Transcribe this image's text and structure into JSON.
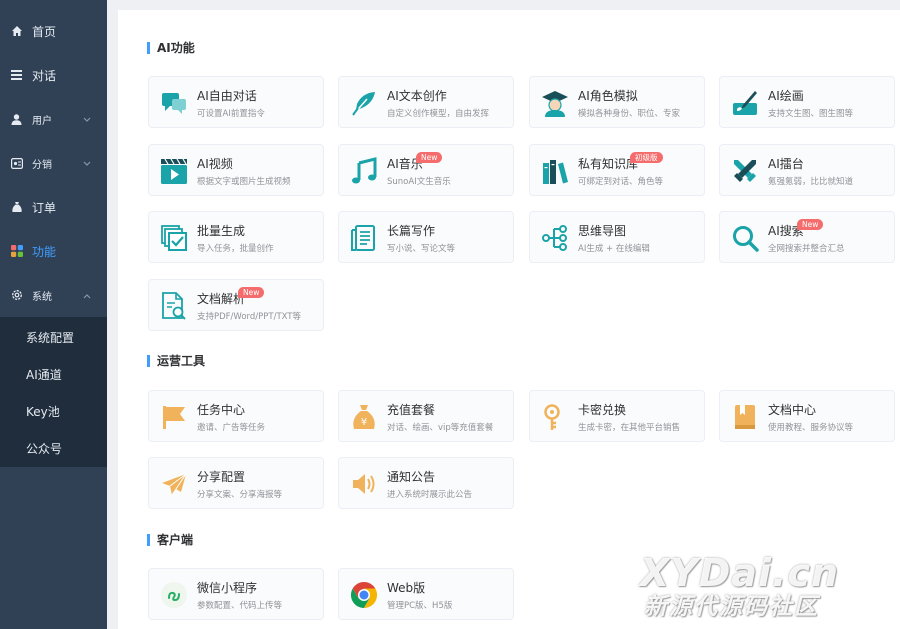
{
  "sidebar": {
    "items": [
      {
        "label": "首页",
        "icon": "home-icon"
      },
      {
        "label": "对话",
        "icon": "menu-icon"
      },
      {
        "label": "用户",
        "icon": "user-icon"
      },
      {
        "label": "分销",
        "icon": "share-icon"
      },
      {
        "label": "订单",
        "icon": "bag-icon"
      },
      {
        "label": "功能",
        "icon": "apps-icon"
      },
      {
        "label": "系统",
        "icon": "gear-icon"
      }
    ],
    "submenu": [
      "系统配置",
      "AI通道",
      "Key池",
      "公众号"
    ],
    "active_color": "#409eff"
  },
  "sections": {
    "ai": {
      "title": "AI功能",
      "cards": [
        {
          "title": "AI自由对话",
          "desc": "可设置AI前置指令",
          "icon": "chat-icon"
        },
        {
          "title": "AI文本创作",
          "desc": "自定义创作模型，自由发挥",
          "icon": "feather-icon"
        },
        {
          "title": "AI角色模拟",
          "desc": "模拟各种身份、职位、专家",
          "icon": "graduate-icon"
        },
        {
          "title": "AI绘画",
          "desc": "支持文生图、图生图等",
          "icon": "paint-icon"
        },
        {
          "title": "AI视频",
          "desc": "根据文字或图片生成视频",
          "icon": "video-icon"
        },
        {
          "title": "AI音乐",
          "desc": "SunoAI文生音乐",
          "icon": "music-icon",
          "badge": "New"
        },
        {
          "title": "私有知识库",
          "desc": "可绑定到对话、角色等",
          "icon": "books-icon",
          "badge": "初级版"
        },
        {
          "title": "AI擂台",
          "desc": "氪强氪弱，比比就知道",
          "icon": "swords-icon"
        },
        {
          "title": "批量生成",
          "desc": "导入任务，批量创作",
          "icon": "batch-icon"
        },
        {
          "title": "长篇写作",
          "desc": "写小说、写论文等",
          "icon": "document-icon"
        },
        {
          "title": "思维导图",
          "desc": "AI生成 + 在线编辑",
          "icon": "mindmap-icon"
        },
        {
          "title": "AI搜索",
          "desc": "全网搜索并整合汇总",
          "icon": "search-icon",
          "badge": "New"
        },
        {
          "title": "文档解析",
          "desc": "支持PDF/Word/PPT/TXT等",
          "icon": "file-search-icon",
          "badge": "New"
        }
      ]
    },
    "ops": {
      "title": "运营工具",
      "cards": [
        {
          "title": "任务中心",
          "desc": "邀请、广告等任务",
          "icon": "flag-icon"
        },
        {
          "title": "充值套餐",
          "desc": "对话、绘画、vip等充值套餐",
          "icon": "money-bag-icon"
        },
        {
          "title": "卡密兑换",
          "desc": "生成卡密，在其他平台销售",
          "icon": "key-icon"
        },
        {
          "title": "文档中心",
          "desc": "使用教程、服务协议等",
          "icon": "book-icon"
        },
        {
          "title": "分享配置",
          "desc": "分享文案、分享海报等",
          "icon": "paper-plane-icon"
        },
        {
          "title": "通知公告",
          "desc": "进入系统时展示此公告",
          "icon": "speaker-icon"
        }
      ]
    },
    "client": {
      "title": "客户端",
      "cards": [
        {
          "title": "微信小程序",
          "desc": "参数配置、代码上传等",
          "icon": "miniprogram-icon"
        },
        {
          "title": "Web版",
          "desc": "管理PC版、H5版",
          "icon": "chrome-icon"
        }
      ]
    }
  },
  "watermark": {
    "line1": "XYDai.cn",
    "line2": "新源代源码社区"
  },
  "colors": {
    "accent": "#409eff",
    "teal": "#1aa3a8",
    "orange": "#f0b35c",
    "badge": "#f56c6c",
    "sidebar_bg": "#304156"
  }
}
